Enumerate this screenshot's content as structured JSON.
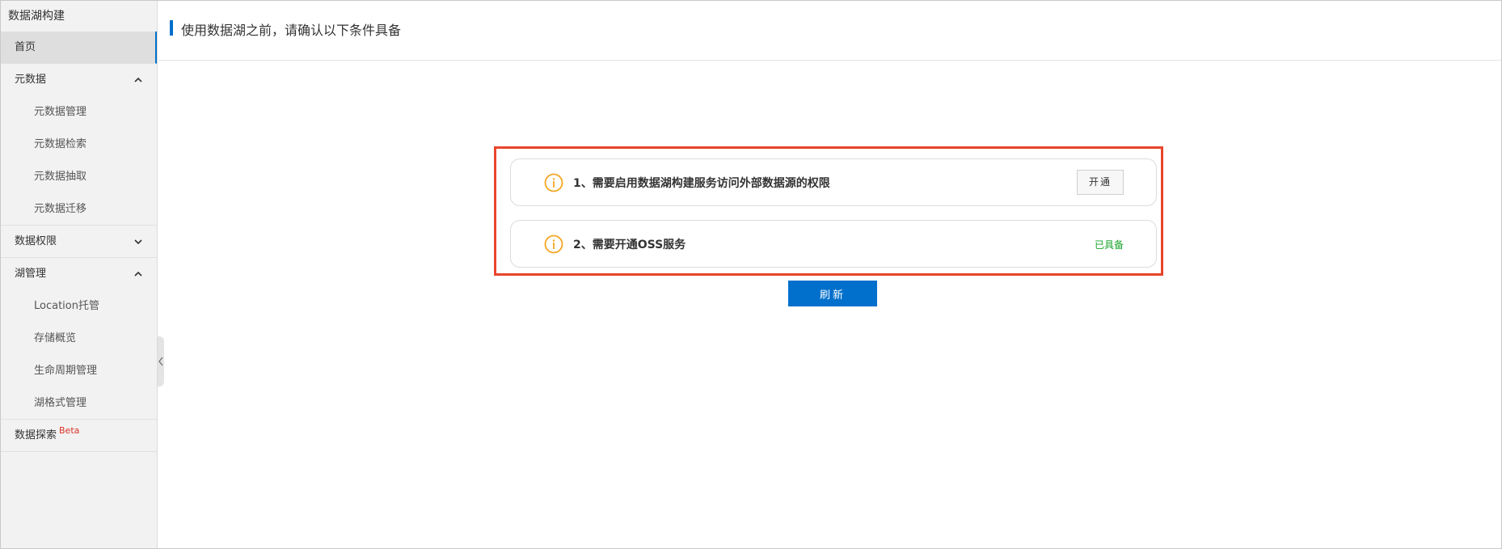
{
  "app": {
    "title": "数据湖构建"
  },
  "sidebar": {
    "home": "首页",
    "metadata": {
      "label": "元数据",
      "items": [
        "元数据管理",
        "元数据检索",
        "元数据抽取",
        "元数据迁移"
      ]
    },
    "permissions": {
      "label": "数据权限"
    },
    "lake": {
      "label": "湖管理",
      "items": [
        "Location托管",
        "存储概览",
        "生命周期管理",
        "湖格式管理"
      ]
    },
    "explore": {
      "label": "数据探索",
      "badge": "Beta"
    }
  },
  "page": {
    "title": "使用数据湖之前，请确认以下条件具备"
  },
  "conditions": [
    {
      "text": "1、需要启用数据湖构建服务访问外部数据源的权限",
      "action": "开通"
    },
    {
      "text": "2、需要开通OSS服务",
      "status": "已具备"
    }
  ],
  "refresh_label": "刷新",
  "colors": {
    "accent": "#0070cc",
    "highlight": "#e8452c",
    "warning_icon": "#f5a623",
    "ready": "#1aa32b",
    "beta": "#d93026"
  },
  "icons": {
    "condition": "info-circle-icon",
    "expanded": "chevron-up-icon",
    "collapsed": "chevron-down-icon",
    "collapse_handle": "chevron-left-icon"
  }
}
